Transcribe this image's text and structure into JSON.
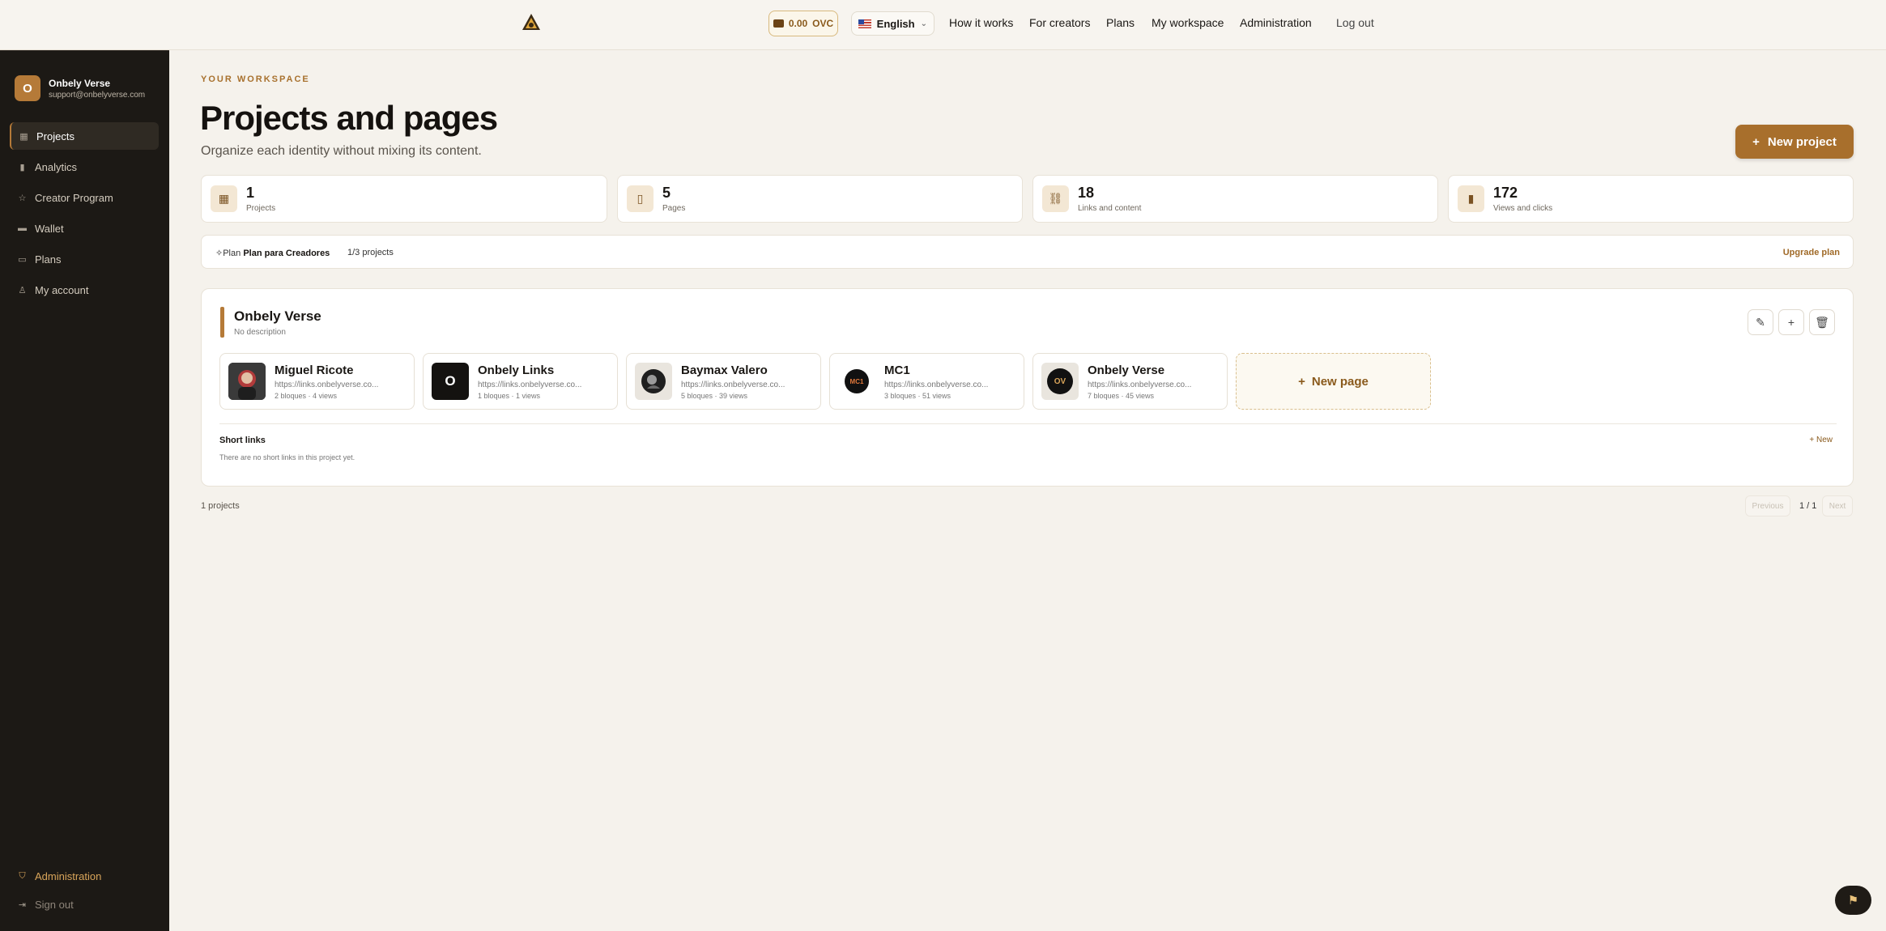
{
  "topbar": {
    "wallet_balance": "0.00",
    "wallet_unit": "OVC",
    "language": "English",
    "nav": [
      "How it works",
      "For creators",
      "Plans",
      "My workspace",
      "Administration",
      "Log out"
    ]
  },
  "sidebar": {
    "user": {
      "initial": "O",
      "name": "Onbely Verse",
      "email": "support@onbelyverse.com"
    },
    "items": [
      {
        "label": "Projects",
        "icon": "grid-icon",
        "active": true
      },
      {
        "label": "Analytics",
        "icon": "bar-chart-icon"
      },
      {
        "label": "Creator Program",
        "icon": "star-icon"
      },
      {
        "label": "Wallet",
        "icon": "wallet-icon"
      },
      {
        "label": "Plans",
        "icon": "card-icon"
      },
      {
        "label": "My account",
        "icon": "user-icon"
      }
    ],
    "bottom": {
      "admin": "Administration",
      "signout": "Sign out"
    }
  },
  "main": {
    "eyebrow": "YOUR WORKSPACE",
    "title": "Projects and pages",
    "subtitle": "Organize each identity without mixing its content.",
    "new_project": "New project",
    "stats": [
      {
        "value": "1",
        "label": "Projects",
        "icon": "grid-icon"
      },
      {
        "value": "5",
        "label": "Pages",
        "icon": "phone-icon"
      },
      {
        "value": "18",
        "label": "Links and content",
        "icon": "link-icon"
      },
      {
        "value": "172",
        "label": "Views and clicks",
        "icon": "bar-chart-icon"
      }
    ],
    "plan": {
      "prefix": "Plan",
      "name": "Plan para Creadores",
      "usage": "1/3 projects",
      "upgrade": "Upgrade plan"
    },
    "project": {
      "name": "Onbely Verse",
      "description": "No description",
      "pages": [
        {
          "name": "Miguel Ricote",
          "url": "https://links.onbelyverse.co...",
          "meta": "2 bloques · 4 views",
          "thumb": ""
        },
        {
          "name": "Onbely Links",
          "url": "https://links.onbelyverse.co...",
          "meta": "1 bloques · 1 views",
          "thumb": "O"
        },
        {
          "name": "Baymax Valero",
          "url": "https://links.onbelyverse.co...",
          "meta": "5 bloques · 39 views",
          "thumb": ""
        },
        {
          "name": "MC1",
          "url": "https://links.onbelyverse.co...",
          "meta": "3 bloques · 51 views",
          "thumb": "MC1"
        },
        {
          "name": "Onbely Verse",
          "url": "https://links.onbelyverse.co...",
          "meta": "7 bloques · 45 views",
          "thumb": "OV"
        }
      ],
      "new_page": "New page",
      "short_links_title": "Short links",
      "short_links_empty": "There are no short links in this project yet.",
      "short_links_new": "New"
    },
    "footer": {
      "count": "1 projects",
      "previous": "Previous",
      "page": "1 / 1",
      "next": "Next"
    }
  }
}
